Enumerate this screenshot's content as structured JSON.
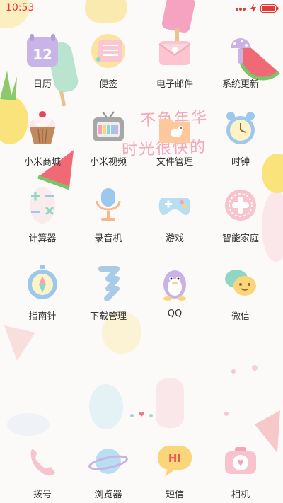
{
  "status_bar": {
    "time": "10:53",
    "accent_color": "#e23a3a"
  },
  "wallpaper": {
    "handwriting_line1": "不负年华",
    "handwriting_line2": "时光很快的"
  },
  "apps": [
    {
      "label": "日历",
      "icon": "calendar-icon",
      "day": "12"
    },
    {
      "label": "便签",
      "icon": "notes-icon"
    },
    {
      "label": "电子邮件",
      "icon": "mail-icon"
    },
    {
      "label": "系统更新",
      "icon": "system-update-icon"
    },
    {
      "label": "小米商城",
      "icon": "cupcake-icon"
    },
    {
      "label": "小米视频",
      "icon": "tv-icon"
    },
    {
      "label": "文件管理",
      "icon": "folder-icon"
    },
    {
      "label": "时钟",
      "icon": "alarm-clock-icon"
    },
    {
      "label": "计算器",
      "icon": "calculator-icon"
    },
    {
      "label": "录音机",
      "icon": "microphone-icon"
    },
    {
      "label": "游戏",
      "icon": "gamepad-icon"
    },
    {
      "label": "智能家庭",
      "icon": "smart-home-icon"
    },
    {
      "label": "指南针",
      "icon": "compass-icon"
    },
    {
      "label": "下载管理",
      "icon": "download-icon"
    },
    {
      "label": "QQ",
      "icon": "qq-penguin-icon"
    },
    {
      "label": "微信",
      "icon": "wechat-icon"
    }
  ],
  "dock": [
    {
      "label": "拨号",
      "icon": "phone-icon"
    },
    {
      "label": "浏览器",
      "icon": "browser-planet-icon"
    },
    {
      "label": "短信",
      "icon": "message-icon",
      "bubble_text": "HI"
    },
    {
      "label": "相机",
      "icon": "camera-icon"
    }
  ]
}
